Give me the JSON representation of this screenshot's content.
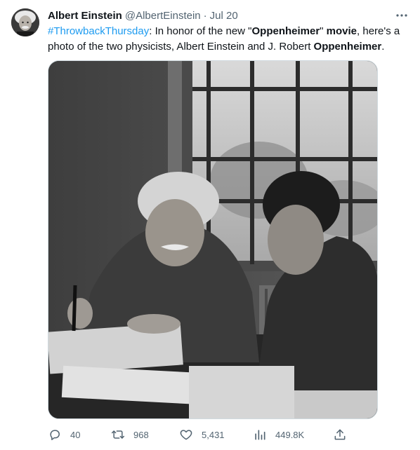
{
  "tweet": {
    "author_name": "Albert Einstein",
    "handle": "@AlbertEinstein",
    "separator": "·",
    "date": "Jul 20",
    "text": {
      "hashtag": "#ThrowbackThursday",
      "part1": ": In honor of the new \"",
      "bold1": "Oppenheimer",
      "part2": "\" ",
      "bold2": "movie",
      "part3": ", here's a photo of the two physicists, Albert Einstein and J. Robert ",
      "bold3": "Oppenheimer",
      "part4": "."
    },
    "more_icon": "more-horizontal-icon"
  },
  "actions": {
    "reply": {
      "icon": "reply-icon",
      "count": "40"
    },
    "retweet": {
      "icon": "retweet-icon",
      "count": "968"
    },
    "like": {
      "icon": "heart-icon",
      "count": "5,431"
    },
    "views": {
      "icon": "views-icon",
      "count": "449.8K"
    },
    "share": {
      "icon": "share-icon"
    }
  },
  "colors": {
    "hashtag": "#1d9bf0",
    "secondary_text": "#536471",
    "primary_text": "#0f1419",
    "border": "#cfd9de"
  }
}
